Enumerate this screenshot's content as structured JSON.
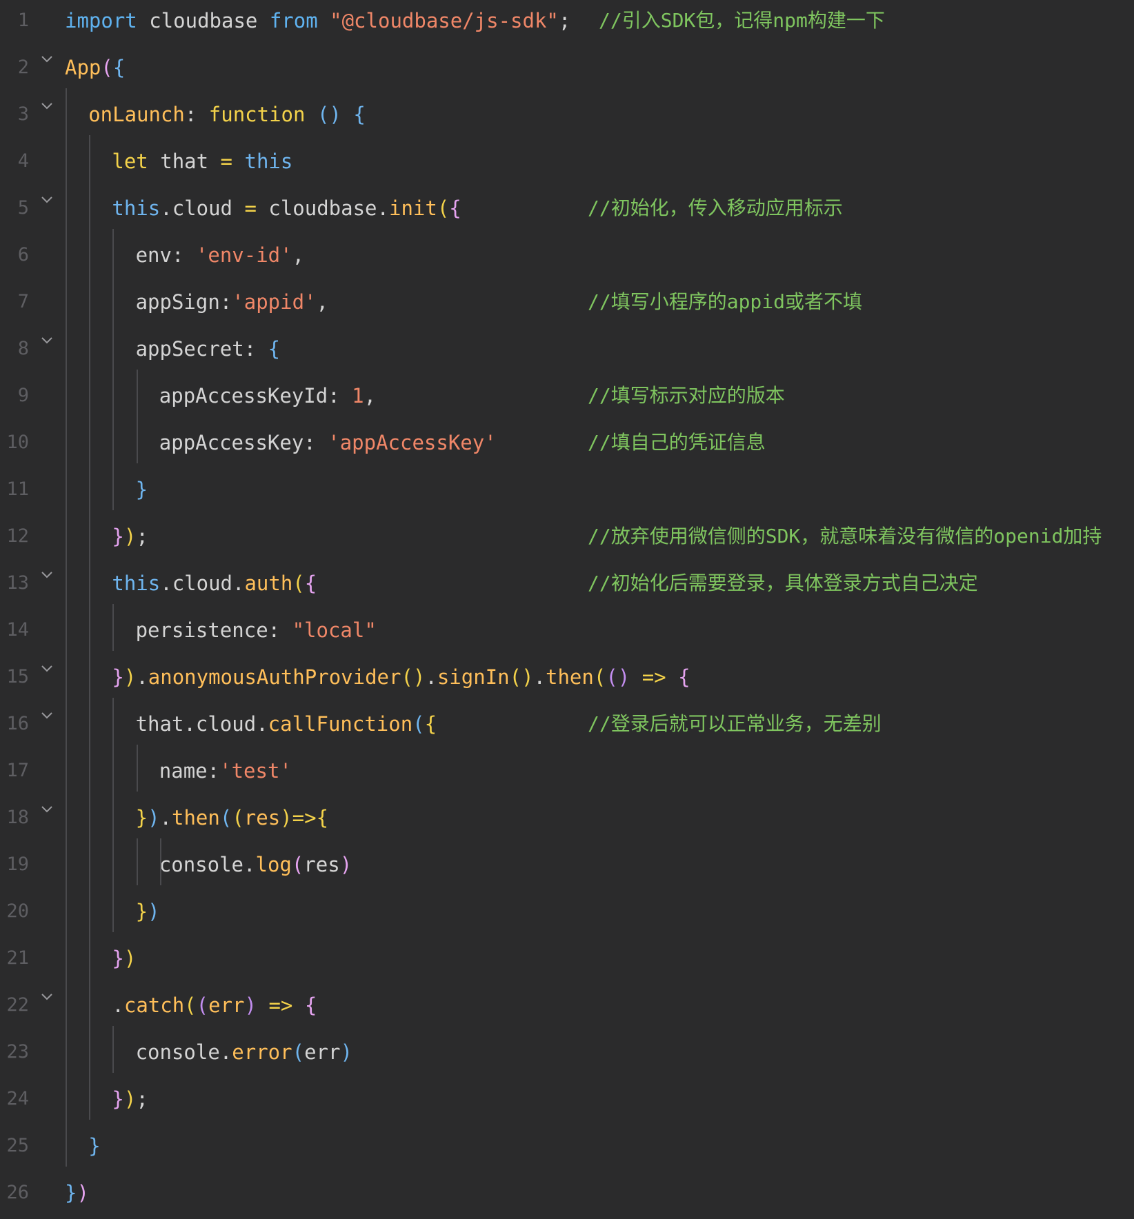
{
  "editor": {
    "lines": [
      {
        "n": "1",
        "tokens": [
          [
            "kw",
            "import"
          ],
          [
            "id",
            " cloudbase "
          ],
          [
            "kw",
            "from"
          ],
          [
            "id",
            " "
          ],
          [
            "str",
            "\"@cloudbase/js-sdk\""
          ],
          [
            "id",
            ";"
          ]
        ],
        "comment": "//引入SDK包，记得npm构建一下"
      },
      {
        "n": "2",
        "tokens": [
          [
            "fn",
            "App"
          ],
          [
            "br1",
            "("
          ],
          [
            "br2",
            "{"
          ]
        ],
        "comment": ""
      },
      {
        "n": "3",
        "tokens": [
          [
            "fn",
            "onLaunch"
          ],
          [
            "id",
            ": "
          ],
          [
            "yw",
            "function"
          ],
          [
            "id",
            " "
          ],
          [
            "br2",
            "()"
          ],
          [
            "id",
            " "
          ],
          [
            "br2",
            "{"
          ]
        ],
        "comment": ""
      },
      {
        "n": "4",
        "tokens": [
          [
            "yw",
            "let"
          ],
          [
            "id",
            " that "
          ],
          [
            "yw",
            "="
          ],
          [
            "id",
            " "
          ],
          [
            "th",
            "this"
          ]
        ],
        "comment": ""
      },
      {
        "n": "5",
        "tokens": [
          [
            "th",
            "this"
          ],
          [
            "id",
            ".cloud "
          ],
          [
            "yw",
            "="
          ],
          [
            "id",
            " cloudbase."
          ],
          [
            "fn",
            "init"
          ],
          [
            "br3",
            "("
          ],
          [
            "br1",
            "{"
          ]
        ],
        "comment": "//初始化，传入移动应用标示"
      },
      {
        "n": "6",
        "tokens": [
          [
            "id",
            "env: "
          ],
          [
            "str",
            "'env-id'"
          ],
          [
            "id",
            ","
          ]
        ],
        "comment": ""
      },
      {
        "n": "7",
        "tokens": [
          [
            "id",
            "appSign:"
          ],
          [
            "str",
            "'appid'"
          ],
          [
            "id",
            ","
          ]
        ],
        "comment": "//填写小程序的appid或者不填"
      },
      {
        "n": "8",
        "tokens": [
          [
            "id",
            "appSecret: "
          ],
          [
            "br2",
            "{"
          ]
        ],
        "comment": ""
      },
      {
        "n": "9",
        "tokens": [
          [
            "id",
            "appAccessKeyId: "
          ],
          [
            "num",
            "1"
          ],
          [
            "id",
            ","
          ]
        ],
        "comment": "//填写标示对应的版本"
      },
      {
        "n": "10",
        "tokens": [
          [
            "id",
            "appAccessKey: "
          ],
          [
            "str",
            "'appAccessKey'"
          ]
        ],
        "comment": "//填自己的凭证信息"
      },
      {
        "n": "11",
        "tokens": [
          [
            "br2",
            "}"
          ]
        ],
        "comment": ""
      },
      {
        "n": "12",
        "tokens": [
          [
            "br1",
            "}"
          ],
          [
            "br3",
            ")"
          ],
          [
            "id",
            ";"
          ]
        ],
        "comment": "//放弃使用微信侧的SDK，就意味着没有微信的openid加持"
      },
      {
        "n": "13",
        "tokens": [
          [
            "th",
            "this"
          ],
          [
            "id",
            ".cloud."
          ],
          [
            "fn",
            "auth"
          ],
          [
            "br3",
            "("
          ],
          [
            "br1",
            "{"
          ]
        ],
        "comment": "//初始化后需要登录，具体登录方式自己决定"
      },
      {
        "n": "14",
        "tokens": [
          [
            "id",
            "persistence: "
          ],
          [
            "str",
            "\"local\""
          ]
        ],
        "comment": ""
      },
      {
        "n": "15",
        "tokens": [
          [
            "br1",
            "}"
          ],
          [
            "br3",
            ")"
          ],
          [
            "id",
            "."
          ],
          [
            "fn",
            "anonymousAuthProvider"
          ],
          [
            "br3",
            "()"
          ],
          [
            "id",
            "."
          ],
          [
            "fn",
            "signIn"
          ],
          [
            "br3",
            "()"
          ],
          [
            "id",
            "."
          ],
          [
            "fn",
            "then"
          ],
          [
            "br3",
            "("
          ],
          [
            "pr",
            "()"
          ],
          [
            "id",
            " "
          ],
          [
            "yw",
            "=>"
          ],
          [
            "id",
            " "
          ],
          [
            "br1",
            "{"
          ]
        ],
        "comment": ""
      },
      {
        "n": "16",
        "tokens": [
          [
            "id",
            "that.cloud."
          ],
          [
            "fn",
            "callFunction"
          ],
          [
            "br2",
            "("
          ],
          [
            "br3",
            "{"
          ]
        ],
        "comment": "//登录后就可以正常业务，无差别"
      },
      {
        "n": "17",
        "tokens": [
          [
            "id",
            "name:"
          ],
          [
            "str",
            "'test'"
          ]
        ],
        "comment": ""
      },
      {
        "n": "18",
        "tokens": [
          [
            "br3",
            "}"
          ],
          [
            "br2",
            ")"
          ],
          [
            "id",
            "."
          ],
          [
            "fn",
            "then"
          ],
          [
            "br2",
            "("
          ],
          [
            "br3",
            "("
          ],
          [
            "fn",
            "res"
          ],
          [
            "br3",
            ")"
          ],
          [
            "yw",
            "=>"
          ],
          [
            "br3",
            "{"
          ]
        ],
        "comment": ""
      },
      {
        "n": "19",
        "tokens": [
          [
            "id",
            "console."
          ],
          [
            "fn",
            "log"
          ],
          [
            "br1",
            "("
          ],
          [
            "id",
            "res"
          ],
          [
            "br1",
            ")"
          ]
        ],
        "comment": ""
      },
      {
        "n": "20",
        "tokens": [
          [
            "br3",
            "}"
          ],
          [
            "br2",
            ")"
          ]
        ],
        "comment": ""
      },
      {
        "n": "21",
        "tokens": [
          [
            "br1",
            "}"
          ],
          [
            "br3",
            ")"
          ]
        ],
        "comment": ""
      },
      {
        "n": "22",
        "tokens": [
          [
            "id",
            "."
          ],
          [
            "fn",
            "catch"
          ],
          [
            "br3",
            "("
          ],
          [
            "pr",
            "("
          ],
          [
            "fn",
            "err"
          ],
          [
            "pr",
            ")"
          ],
          [
            "id",
            " "
          ],
          [
            "yw",
            "=>"
          ],
          [
            "id",
            " "
          ],
          [
            "br1",
            "{"
          ]
        ],
        "comment": ""
      },
      {
        "n": "23",
        "tokens": [
          [
            "id",
            "console."
          ],
          [
            "fn",
            "error"
          ],
          [
            "br2",
            "("
          ],
          [
            "id",
            "err"
          ],
          [
            "br2",
            ")"
          ]
        ],
        "comment": ""
      },
      {
        "n": "24",
        "tokens": [
          [
            "br1",
            "}"
          ],
          [
            "br3",
            ")"
          ],
          [
            "id",
            ";"
          ]
        ],
        "comment": ""
      },
      {
        "n": "25",
        "tokens": [
          [
            "br2",
            "}"
          ]
        ],
        "comment": ""
      },
      {
        "n": "26",
        "tokens": [
          [
            "br2",
            "}"
          ],
          [
            "br1",
            ")"
          ]
        ],
        "comment": ""
      }
    ],
    "colors": {
      "background": "#2b2b2c",
      "comment": "#7fc55f",
      "keyword": "#5fb2ef",
      "function": "#ffbf5a",
      "string": "#f08768"
    },
    "fold_icon": "chevron-down-icon"
  }
}
